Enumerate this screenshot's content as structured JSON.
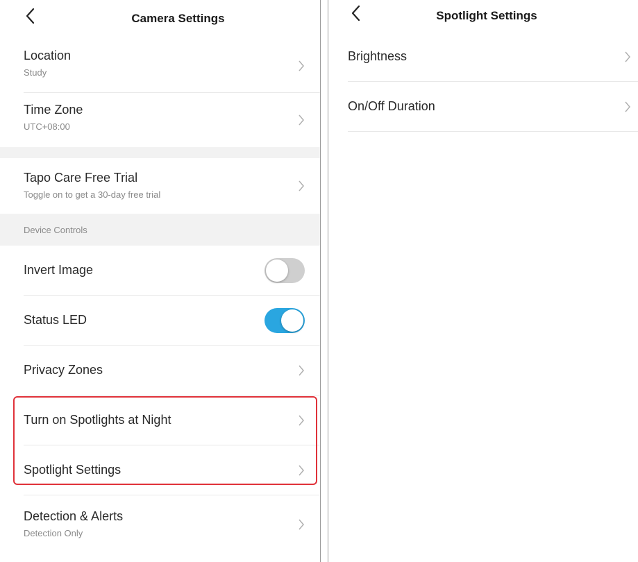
{
  "left": {
    "title": "Camera Settings",
    "rows_top": [
      {
        "label": "Location",
        "sub": "Study"
      },
      {
        "label": "Time Zone",
        "sub": "UTC+08:00"
      }
    ],
    "trial": {
      "label": "Tapo Care Free Trial",
      "sub": "Toggle on to get a 30-day free trial"
    },
    "section": "Device Controls",
    "invert_image": {
      "label": "Invert Image",
      "state": "off"
    },
    "status_led": {
      "label": "Status LED",
      "state": "on"
    },
    "privacy_zones": "Privacy Zones",
    "spotlights_night": "Turn on Spotlights at Night",
    "spotlight_settings": "Spotlight Settings",
    "detection": {
      "label": "Detection & Alerts",
      "sub": "Detection Only"
    }
  },
  "right": {
    "title": "Spotlight Settings",
    "rows": [
      "Brightness",
      "On/Off Duration"
    ]
  },
  "colors": {
    "toggle_on": "#2aa6e0",
    "toggle_off": "#cfcfcf",
    "highlight": "#e0323a"
  }
}
